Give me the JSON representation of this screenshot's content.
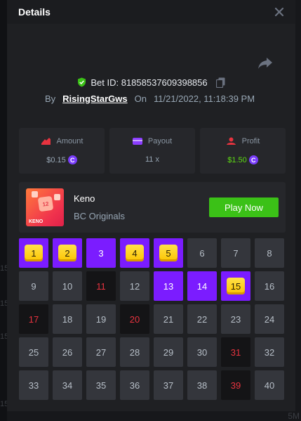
{
  "modal": {
    "title": "Details"
  },
  "bet": {
    "id_label": "Bet ID: 81858537609398856",
    "by_label": "By",
    "user": "RisingStarGws",
    "on_label": "On",
    "date": "11/21/2022, 11:18:39 PM"
  },
  "stats": {
    "amount": {
      "label": "Amount",
      "value": "$0.15"
    },
    "payout": {
      "label": "Payout",
      "value": "11 x"
    },
    "profit": {
      "label": "Profit",
      "value": "$1.50"
    },
    "coin_glyph": "C"
  },
  "game": {
    "name": "Keno",
    "provider": "BC Originals",
    "play_label": "Play Now",
    "thumb_label": "KENO",
    "thumb_ball": "12"
  },
  "grid": {
    "cells": [
      {
        "n": "1",
        "state": "hit"
      },
      {
        "n": "2",
        "state": "hit"
      },
      {
        "n": "3",
        "state": "picked"
      },
      {
        "n": "4",
        "state": "hit"
      },
      {
        "n": "5",
        "state": "hit"
      },
      {
        "n": "6",
        "state": "normal"
      },
      {
        "n": "7",
        "state": "normal"
      },
      {
        "n": "8",
        "state": "normal"
      },
      {
        "n": "9",
        "state": "normal"
      },
      {
        "n": "10",
        "state": "normal"
      },
      {
        "n": "11",
        "state": "drawn"
      },
      {
        "n": "12",
        "state": "normal"
      },
      {
        "n": "13",
        "state": "picked"
      },
      {
        "n": "14",
        "state": "picked"
      },
      {
        "n": "15",
        "state": "hit"
      },
      {
        "n": "16",
        "state": "normal"
      },
      {
        "n": "17",
        "state": "drawn"
      },
      {
        "n": "18",
        "state": "normal"
      },
      {
        "n": "19",
        "state": "normal"
      },
      {
        "n": "20",
        "state": "drawn"
      },
      {
        "n": "21",
        "state": "normal"
      },
      {
        "n": "22",
        "state": "normal"
      },
      {
        "n": "23",
        "state": "normal"
      },
      {
        "n": "24",
        "state": "normal"
      },
      {
        "n": "25",
        "state": "normal"
      },
      {
        "n": "26",
        "state": "normal"
      },
      {
        "n": "27",
        "state": "normal"
      },
      {
        "n": "28",
        "state": "normal"
      },
      {
        "n": "29",
        "state": "normal"
      },
      {
        "n": "30",
        "state": "normal"
      },
      {
        "n": "31",
        "state": "drawn"
      },
      {
        "n": "32",
        "state": "normal"
      },
      {
        "n": "33",
        "state": "normal"
      },
      {
        "n": "34",
        "state": "normal"
      },
      {
        "n": "35",
        "state": "normal"
      },
      {
        "n": "36",
        "state": "normal"
      },
      {
        "n": "37",
        "state": "normal"
      },
      {
        "n": "38",
        "state": "normal"
      },
      {
        "n": "39",
        "state": "drawn"
      },
      {
        "n": "40",
        "state": "normal"
      }
    ]
  },
  "backdrop": {
    "left_fragments": [
      "15",
      "15",
      "15",
      "15"
    ],
    "bottom_right": "5M"
  },
  "colors": {
    "purple": "#7b1cff",
    "green_button": "#3bc117",
    "profit_green": "#5edb14",
    "drawn_red": "#e8333f",
    "chip_yellow": "#fcc400"
  }
}
